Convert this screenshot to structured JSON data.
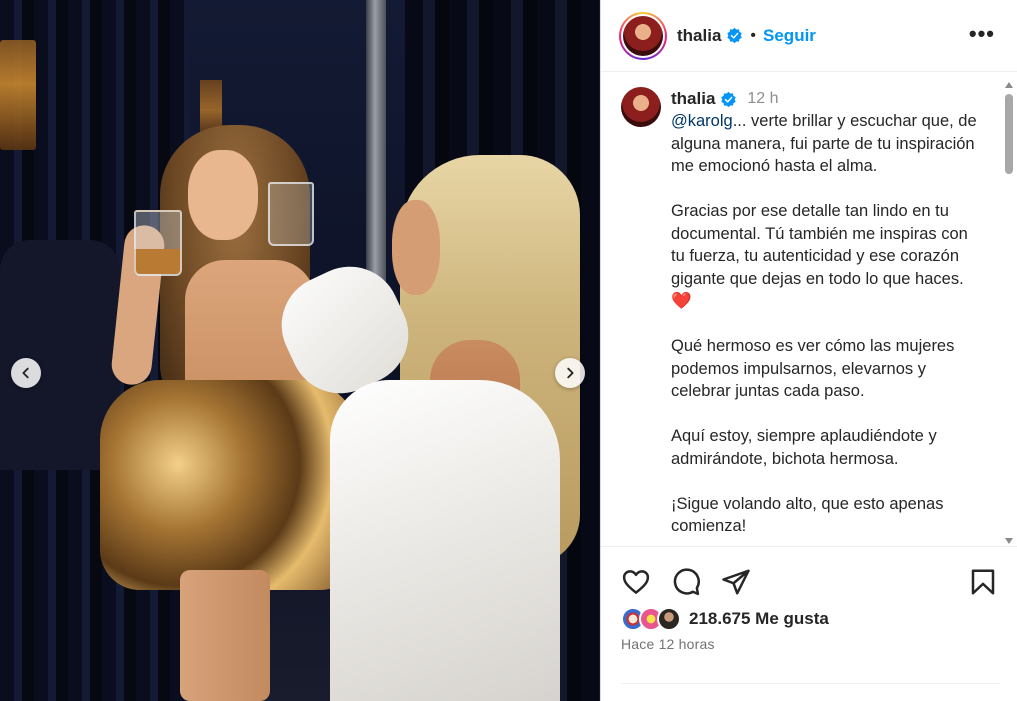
{
  "photo": {
    "prev_label": "‹",
    "next_label": "›"
  },
  "header": {
    "username": "thalia",
    "separator": "•",
    "follow_label": "Seguir",
    "more_label": "•••"
  },
  "caption": {
    "username": "thalia",
    "time": "12 h",
    "mention": "@karolg",
    "paragraphs": [
      "... verte brillar y escuchar que, de alguna manera, fui parte de tu inspiración me emocionó hasta el alma.",
      "Gracias por ese detalle tan lindo en tu documental. Tú también me inspiras con tu fuerza, tu autenticidad y ese corazón gigante que dejas en todo lo que haces.",
      "Qué hermoso es ver cómo las mujeres podemos impulsarnos, elevarnos y celebrar juntas cada paso.",
      "Aquí estoy, siempre aplaudiéndote y admirándote, bichota hermosa.",
      "¡Sigue volando alto, que esto apenas comienza!"
    ],
    "heart_emoji": "❤️"
  },
  "actions": {
    "likes": "218.675 Me gusta",
    "ago": "Hace 12 horas"
  },
  "colors": {
    "accent": "#0095f6",
    "verified": "#0095f6",
    "text": "#262626",
    "muted": "#737373"
  },
  "icons": [
    "chevron-left-icon",
    "chevron-right-icon",
    "verified-badge-icon",
    "more-icon",
    "heart-icon",
    "comment-icon",
    "share-icon",
    "bookmark-icon"
  ]
}
